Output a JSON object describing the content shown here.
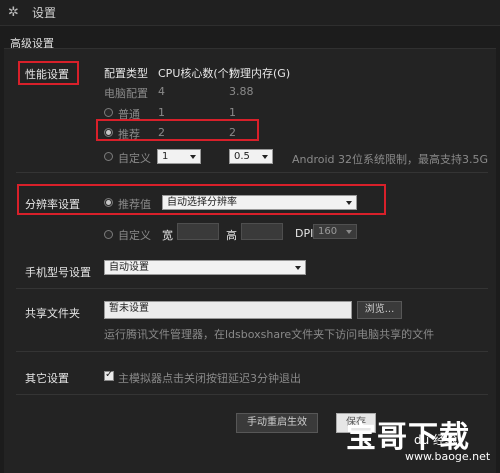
{
  "window": {
    "title": "设置"
  },
  "section_title": "高级设置",
  "performance": {
    "label": "性能设置",
    "col_headers": {
      "type": "配置类型",
      "cpu": "CPU核心数(个)",
      "mem": "物理内存(G)"
    },
    "rows": [
      {
        "label": "电脑配置",
        "cpu": "4",
        "mem": "3.88"
      },
      {
        "label": "普通",
        "cpu": "1",
        "mem": "1"
      },
      {
        "label": "推荐",
        "cpu": "2",
        "mem": "2"
      }
    ],
    "custom": {
      "label": "自定义",
      "cpu_value": "1",
      "mem_value": "0.5",
      "note": "Android 32位系统限制，最高支持3.5G"
    }
  },
  "resolution": {
    "label": "分辨率设置",
    "recommended_label": "推荐值",
    "recommended_value": "自动选择分辨率",
    "custom_label": "自定义",
    "width_label": "宽",
    "height_label": "高",
    "dpi_label": "DPI",
    "dpi_value": "160"
  },
  "phone_model": {
    "label": "手机型号设置",
    "value": "自动设置"
  },
  "shared_folder": {
    "label": "共享文件夹",
    "value": "暂未设置",
    "browse_label": "浏览...",
    "hint": "运行腾讯文件管理器，在ldsboxshare文件夹下访问电脑共享的文件"
  },
  "other": {
    "label": "其它设置",
    "checkbox_label": "主模拟器点击关闭按钮延迟3分钟退出"
  },
  "footer": {
    "restart_label": "手动重启生效",
    "save_label": "保存"
  },
  "watermark": {
    "main": "宝哥下载",
    "du": "du 经验",
    "url": "www.baoge.net"
  }
}
